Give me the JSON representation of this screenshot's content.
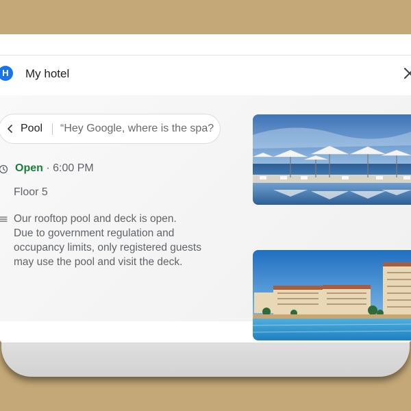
{
  "header": {
    "avatar_letter": "H",
    "title": "My hotel"
  },
  "query_chip": {
    "label": "Pool",
    "query": "“Hey Google, where is the spa?"
  },
  "details": {
    "status": "Open",
    "separator": " · ",
    "time": "6:00 PM",
    "floor": "Floor 5",
    "description_lines": [
      "Our rooftop pool and deck is open.",
      "Due to government regulation and",
      "occupancy limits, only registered guests",
      "may use the pool and visit the deck."
    ]
  },
  "icons": {
    "avatar": "avatar-icon",
    "close": "close-icon",
    "back": "chevron-left-icon",
    "hours": "clock-icon",
    "description": "notes-icon"
  },
  "colors": {
    "background": "#c4a877",
    "avatar": "#1a73e8",
    "open_status": "#188038",
    "secondary_text": "#5f6368"
  },
  "photos": [
    {
      "name": "rooftop-pool-umbrellas-photo"
    },
    {
      "name": "hotel-pool-photo"
    }
  ]
}
